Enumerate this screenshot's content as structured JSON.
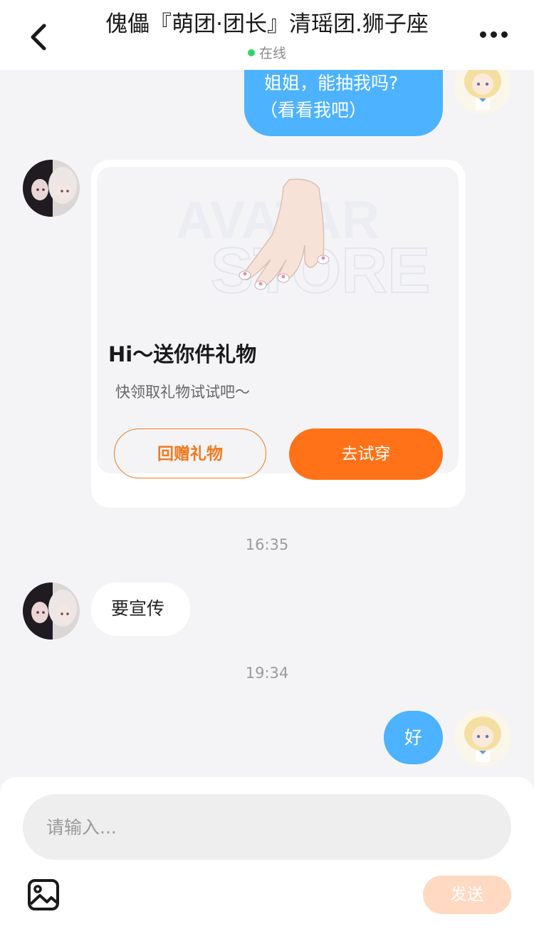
{
  "header": {
    "title": "傀儡『萌团·团长』清瑶团.狮子座",
    "status": "在线"
  },
  "messages": {
    "m1_line1": "姐姐，能抽我吗?",
    "m1_line2": "（看看我吧）",
    "card": {
      "watermark_line1": "AVATAR",
      "watermark_line2": "STORE",
      "title": "Hi～送你件礼物",
      "subtitle": "快领取礼物试试吧～",
      "btn_return": "回赠礼物",
      "btn_try": "去试穿"
    },
    "time1": "16:35",
    "m2": "要宣传",
    "time2": "19:34",
    "m3": "好"
  },
  "footer": {
    "input_placeholder": "请输入...",
    "send_label": "发送"
  },
  "colors": {
    "accent_orange": "#ff7217",
    "bubble_blue": "#4db2ff",
    "online_green": "#2fd567"
  }
}
